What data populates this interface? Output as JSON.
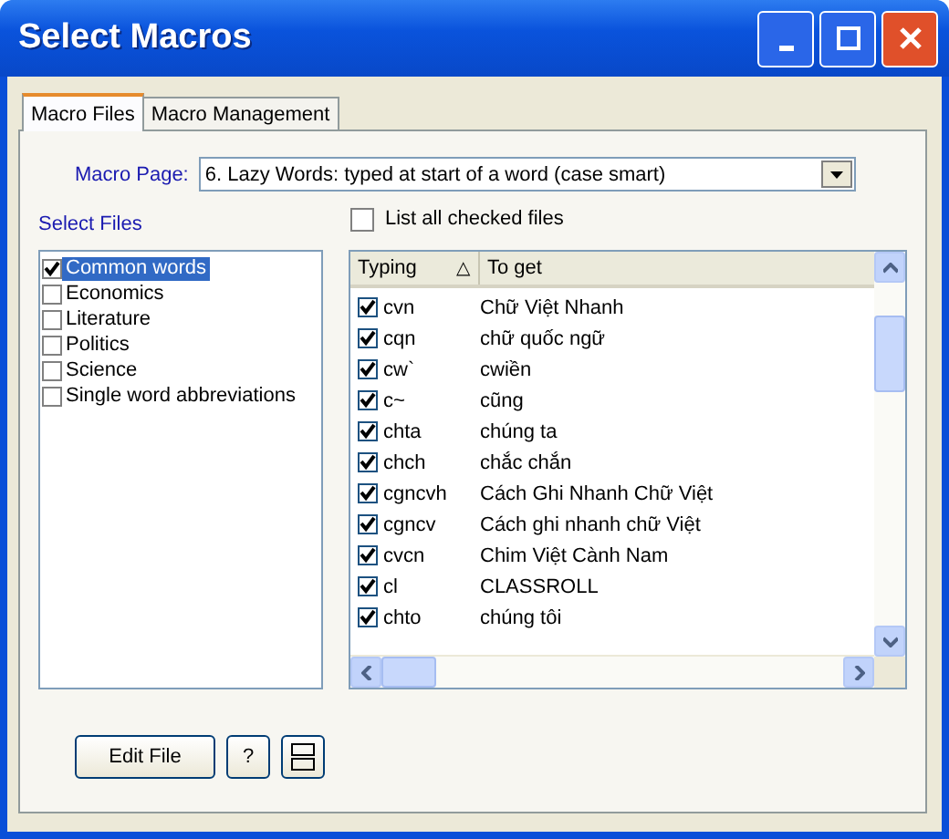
{
  "window": {
    "title": "Select Macros"
  },
  "tabs": [
    {
      "label": "Macro Files",
      "selected": true
    },
    {
      "label": "Macro Management",
      "selected": false
    }
  ],
  "macro_page": {
    "label": "Macro Page:",
    "value": "6. Lazy Words: typed at start of a word (case smart)"
  },
  "select_files": {
    "label": "Select Files"
  },
  "list_all_checked": {
    "label": "List all checked files",
    "checked": false
  },
  "files": [
    {
      "name": "Common words",
      "checked": true,
      "selected": true
    },
    {
      "name": "Economics",
      "checked": false,
      "selected": false
    },
    {
      "name": "Literature",
      "checked": false,
      "selected": false
    },
    {
      "name": "Politics",
      "checked": false,
      "selected": false
    },
    {
      "name": "Science",
      "checked": false,
      "selected": false
    },
    {
      "name": "Single word abbreviations",
      "checked": false,
      "selected": false
    }
  ],
  "table": {
    "columns": [
      {
        "label": "Typing",
        "sort_mark": "△"
      },
      {
        "label": "To get"
      }
    ],
    "rows": [
      {
        "typing": "cvn",
        "to_get": "Chữ Việt Nhanh",
        "checked": true
      },
      {
        "typing": "cqn",
        "to_get": "chữ quốc ngữ",
        "checked": true
      },
      {
        "typing": "cw`",
        "to_get": "cwiền",
        "checked": true
      },
      {
        "typing": "c~",
        "to_get": "cũng",
        "checked": true
      },
      {
        "typing": "chta",
        "to_get": "chúng ta",
        "checked": true
      },
      {
        "typing": "chch",
        "to_get": "chắc chắn",
        "checked": true
      },
      {
        "typing": "cgncvh",
        "to_get": "Cách Ghi Nhanh Chữ Việt",
        "checked": true
      },
      {
        "typing": "cgncv",
        "to_get": "Cách ghi nhanh chữ Việt",
        "checked": true
      },
      {
        "typing": "cvcn",
        "to_get": "Chim Việt Cành Nam",
        "checked": true
      },
      {
        "typing": "cl",
        "to_get": "CLASSROLL",
        "checked": true
      },
      {
        "typing": "chto",
        "to_get": "chúng tôi",
        "checked": true
      }
    ]
  },
  "buttons": [
    {
      "kind": "text",
      "label": "Edit File"
    },
    {
      "kind": "text",
      "label": "?"
    },
    {
      "kind": "layout"
    }
  ]
}
